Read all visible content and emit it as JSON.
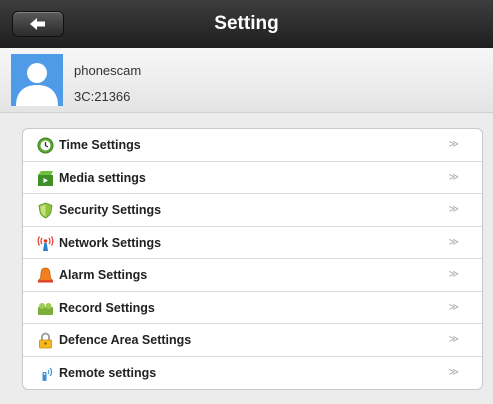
{
  "header": {
    "title": "Setting",
    "back_icon": "back-arrow-icon"
  },
  "profile": {
    "name": "phonescam",
    "id": "3C:21366",
    "avatar_icon": "user-avatar-icon"
  },
  "menu": {
    "chevron": "≫",
    "items": [
      {
        "label": "Time Settings",
        "icon": "clock-icon"
      },
      {
        "label": "Media settings",
        "icon": "media-icon"
      },
      {
        "label": "Security Settings",
        "icon": "shield-icon"
      },
      {
        "label": "Network Settings",
        "icon": "antenna-icon"
      },
      {
        "label": "Alarm Settings",
        "icon": "bell-icon"
      },
      {
        "label": "Record Settings",
        "icon": "record-icon"
      },
      {
        "label": "Defence Area Settings",
        "icon": "lock-icon"
      },
      {
        "label": "Remote settings",
        "icon": "remote-icon"
      }
    ]
  }
}
